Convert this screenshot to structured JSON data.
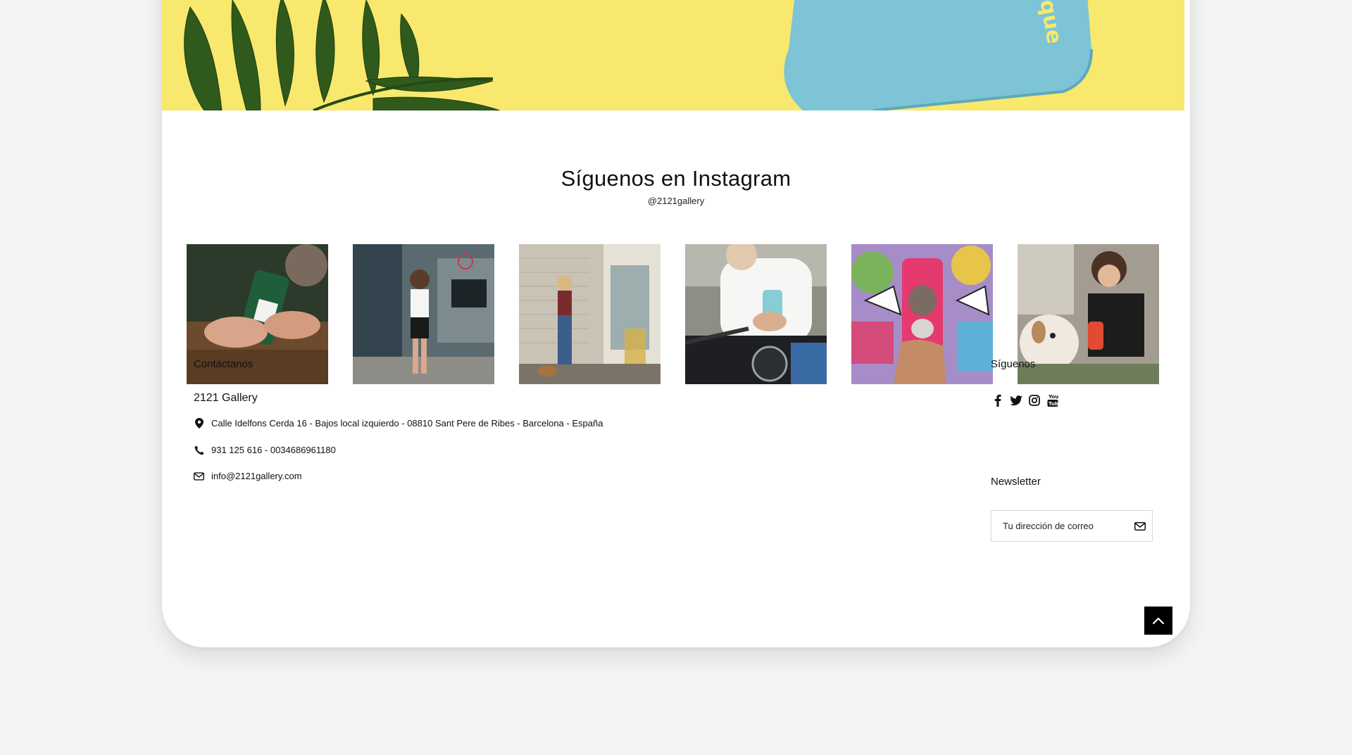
{
  "instagram": {
    "title": "Síguenos en Instagram",
    "handle": "@2121gallery",
    "photos": [
      {
        "subject": "hands holding green phone case over wooden table"
      },
      {
        "subject": "woman in white top using phone in graffiti courtyard"
      },
      {
        "subject": "woman leaning on brick wall with dog and skateboard"
      },
      {
        "subject": "man in white t-shirt on motorcycle holding blue phone"
      },
      {
        "subject": "hand holding pink phone case with dog against graffiti"
      },
      {
        "subject": "woman with small white dog holding red phone case"
      }
    ]
  },
  "footer": {
    "contact_heading": "Contáctanos",
    "brand": "2121 Gallery",
    "address": "Calle Idelfons Cerda 16 - Bajos local izquierdo - 08810 Sant Pere de Ribes - Barcelona - España",
    "phone": "931 125 616 - 0034686961180",
    "email": "info@2121gallery.com",
    "follow_heading": "Síguenos",
    "social_icons": [
      "facebook-icon",
      "twitter-icon",
      "instagram-icon",
      "youtube-icon"
    ],
    "newsletter_heading": "Newsletter",
    "newsletter_placeholder": "Tu dirección de correo"
  },
  "colors": {
    "hero_yellow": "#f8e86d",
    "case_blue": "#7cc4d6",
    "text": "#111111",
    "back_to_top_bg": "#000000"
  }
}
